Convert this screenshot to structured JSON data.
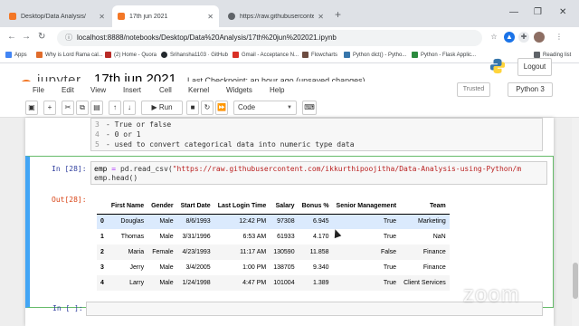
{
  "browser": {
    "tabs": [
      {
        "label": "Desktop/Data Analysis/",
        "fav_color": "#f37726",
        "active": false
      },
      {
        "label": "17th jun 2021",
        "fav_color": "#f37726",
        "active": true
      },
      {
        "label": "https://raw.githubusercontent.com",
        "fav_color": "#5f6368",
        "active": false
      }
    ],
    "new_tab": "+",
    "address": "localhost:8888/notebooks/Desktop/Data%20Analysis/17th%20jun%202021.ipynb",
    "bookmarks": [
      {
        "label": "Apps",
        "color": "#4285f4"
      },
      {
        "label": "Why is Lord Rama cal...",
        "color": "#e06c2b"
      },
      {
        "label": "(2) Home - Quora",
        "color": "#b92b27"
      },
      {
        "label": "Srihansha1103 · GitHub",
        "color": "#24292e"
      },
      {
        "label": "Gmail - Acceptance N...",
        "color": "#d93025"
      },
      {
        "label": "Flowcharts",
        "color": "#6d4c41"
      },
      {
        "label": "Python dict() - Pytho...",
        "color": "#3776ab"
      },
      {
        "label": "Python - Flask Applic...",
        "color": "#2b8a3e"
      }
    ],
    "reading_list": "Reading list"
  },
  "jupyter": {
    "logo_text": "jupyter",
    "notebook_name": "17th jun 2021",
    "checkpoint": "Last Checkpoint: an hour ago  (unsaved changes)",
    "logout": "Logout",
    "menu": [
      "File",
      "Edit",
      "View",
      "Insert",
      "Cell",
      "Kernel",
      "Widgets",
      "Help"
    ],
    "trusted": "Trusted",
    "kernel": "Python 3",
    "toolbar": {
      "run": "Run",
      "cell_type": "Code"
    }
  },
  "notebook": {
    "markdown_lines": [
      {
        "num": "3",
        "text": "- True or false"
      },
      {
        "num": "4",
        "text": "- 0 or 1"
      },
      {
        "num": "5",
        "text": "- used to convert categorical data into numeric type data"
      }
    ],
    "in_prompt": "In [28]:",
    "out_prompt": "Out[28]:",
    "code_line1_var": "emp",
    "code_line1_op": "=",
    "code_line1_call": "pd.read_csv(",
    "code_line1_str": "\"https://raw.githubusercontent.com/ikkurthipoojitha/Data-Analysis-using-Python/m",
    "code_line2": "emp.head()",
    "columns": [
      "",
      "First Name",
      "Gender",
      "Start Date",
      "Last Login Time",
      "Salary",
      "Bonus %",
      "Senior Management",
      "Team"
    ],
    "rows": [
      [
        "0",
        "Douglas",
        "Male",
        "8/6/1993",
        "12:42 PM",
        "97308",
        "6.945",
        "True",
        "Marketing"
      ],
      [
        "1",
        "Thomas",
        "Male",
        "3/31/1996",
        "6:53 AM",
        "61933",
        "4.170",
        "True",
        "NaN"
      ],
      [
        "2",
        "Maria",
        "Female",
        "4/23/1993",
        "11:17 AM",
        "130590",
        "11.858",
        "False",
        "Finance"
      ],
      [
        "3",
        "Jerry",
        "Male",
        "3/4/2005",
        "1:00 PM",
        "138705",
        "9.340",
        "True",
        "Finance"
      ],
      [
        "4",
        "Larry",
        "Male",
        "1/24/1998",
        "4:47 PM",
        "101004",
        "1.389",
        "True",
        "Client Services"
      ]
    ],
    "next_prompt": "In [ ]:"
  },
  "overlay": {
    "zoom_watermark": "zoom"
  }
}
